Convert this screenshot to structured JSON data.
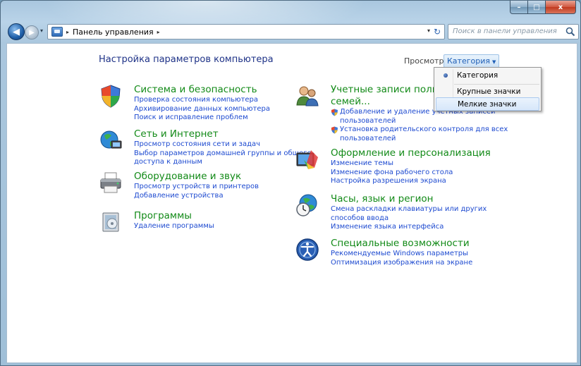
{
  "window": {
    "caption": {
      "minimize": "–",
      "maximize": "□",
      "close": "x"
    }
  },
  "nav": {
    "back_glyph": "◀",
    "forward_glyph": "▶",
    "recent_glyph": "▾",
    "breadcrumb": {
      "root_sep": "▸",
      "location": "Панель управления",
      "end_sep": "▸"
    },
    "address_dropdown_glyph": "▾",
    "refresh_glyph": "↻",
    "search_placeholder": "Поиск в панели управления"
  },
  "content": {
    "title": "Настройка параметров компьютера",
    "view": {
      "label": "Просмотр:",
      "selected": "Категория",
      "arrow": "▼"
    },
    "categories": [
      {
        "title": "Система и безопасность",
        "icon": "shield-icon",
        "links": [
          "Проверка состояния компьютера",
          "Архивирование данных компьютера",
          "Поиск и исправление проблем"
        ]
      },
      {
        "title": "Сеть и Интернет",
        "icon": "globe-network-icon",
        "links": [
          "Просмотр состояния сети и задач",
          "Выбор параметров домашней группы и общего",
          "доступа к данным"
        ]
      },
      {
        "title": "Оборудование и звук",
        "icon": "printer-icon",
        "links": [
          "Просмотр устройств и принтеров",
          "Добавление устройства"
        ]
      },
      {
        "title": "Программы",
        "icon": "programs-icon",
        "links": [
          "Удаление программы"
        ]
      },
      {
        "title_line1": "Учетные записи пользовате",
        "title_line2": "семей...",
        "icon": "users-icon",
        "links": [
          "Добавление и удаление учетных записей",
          "пользователей",
          "Установка родительского контроля для всех",
          "пользователей"
        ]
      },
      {
        "title": "Оформление и персонализация",
        "icon": "personalization-icon",
        "links": [
          "Изменение темы",
          "Изменение фона рабочего стола",
          "Настройка разрешения экрана"
        ]
      },
      {
        "title": "Часы, язык и регион",
        "icon": "clock-globe-icon",
        "links": [
          "Смена раскладки клавиатуры или других",
          "способов ввода",
          "Изменение языка интерфейса"
        ]
      },
      {
        "title": "Специальные возможности",
        "icon": "accessibility-icon",
        "links": [
          "Рекомендуемые Windows параметры",
          "Оптимизация изображения на экране"
        ]
      }
    ]
  },
  "view_menu": {
    "items": [
      "Категория",
      "Крупные значки",
      "Мелкие значки"
    ],
    "checked": "Категория",
    "hovered": "Мелкие значки"
  },
  "colors": {
    "category_title": "#128a17",
    "link": "#1d4ad0",
    "page_title": "#1e3287"
  }
}
